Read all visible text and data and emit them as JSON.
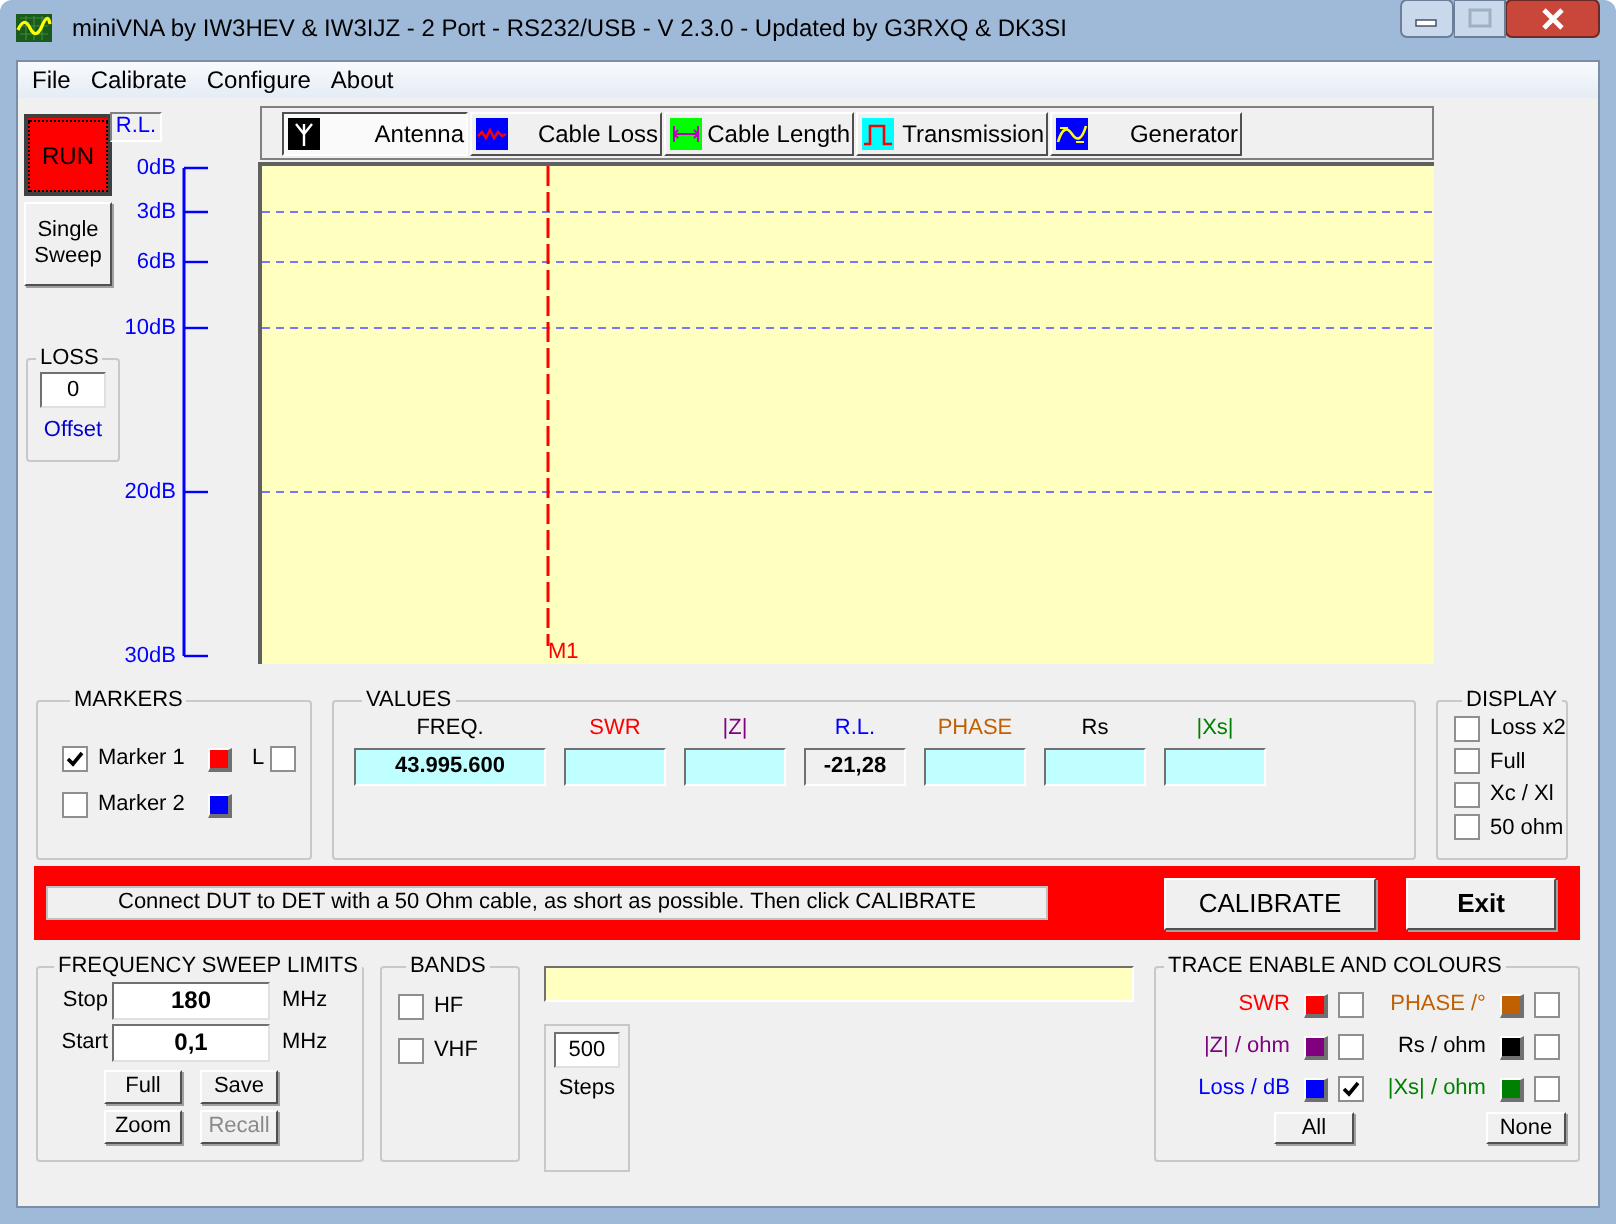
{
  "window": {
    "title": "miniVNA by IW3HEV & IW3IJZ - 2 Port - RS232/USB - V 2.3.0 - Updated by G3RXQ & DK3SI"
  },
  "menu": [
    "File",
    "Calibrate",
    "Configure",
    "About"
  ],
  "run_button": {
    "label": "RUN"
  },
  "single_sweep_button": {
    "label": "Single Sweep"
  },
  "loss": {
    "title": "LOSS",
    "value": "0",
    "label": "Offset"
  },
  "scale": {
    "title": "R.L.",
    "ticks": [
      "0dB",
      "3dB",
      "6dB",
      "10dB",
      "20dB",
      "30dB"
    ]
  },
  "tabs": [
    {
      "label": "Antenna",
      "selected": true
    },
    {
      "label": "Cable Loss",
      "selected": false
    },
    {
      "label": "Cable Length",
      "selected": false
    },
    {
      "label": "Transmission",
      "selected": false
    },
    {
      "label": "Generator",
      "selected": false
    }
  ],
  "marker_line": {
    "label": "M1"
  },
  "markers": {
    "title": "MARKERS",
    "items": [
      {
        "label": "Marker 1",
        "checked": true,
        "color": "#ff0000"
      },
      {
        "label": "Marker 2",
        "checked": false,
        "color": "#0000ff"
      }
    ],
    "l_label": "L",
    "l_checked": false
  },
  "values": {
    "title": "VALUES",
    "fields": [
      {
        "label": "FREQ.",
        "color": "#000000",
        "value": "43.995.600"
      },
      {
        "label": "SWR",
        "color": "#ff0000"
      },
      {
        "label": "|Z|",
        "color": "#800080"
      },
      {
        "label": "R.L.",
        "color": "#0000ff",
        "value": "-21,28"
      },
      {
        "label": "PHASE",
        "color": "#c06000"
      },
      {
        "label": "Rs",
        "color": "#000000"
      },
      {
        "label": "|Xs|",
        "color": "#008000"
      }
    ]
  },
  "display": {
    "title": "DISPLAY",
    "options": [
      {
        "label": "Loss x2",
        "checked": false
      },
      {
        "label": "Full",
        "checked": false
      },
      {
        "label": "Xc / Xl",
        "checked": false
      },
      {
        "label": "50 ohm",
        "checked": false
      }
    ]
  },
  "calibration": {
    "message": "Connect DUT to DET with a 50 Ohm cable, as short as possible. Then click CALIBRATE",
    "calibrate_button": "CALIBRATE",
    "exit_button": "Exit"
  },
  "sweep": {
    "title": "FREQUENCY SWEEP LIMITS",
    "stop": {
      "label": "Stop",
      "value": "180",
      "unit": "MHz"
    },
    "start": {
      "label": "Start",
      "value": "0,1",
      "unit": "MHz"
    },
    "buttons": [
      {
        "label": "Full",
        "disabled": false
      },
      {
        "label": "Save",
        "disabled": false
      },
      {
        "label": "Zoom",
        "disabled": false
      },
      {
        "label": "Recall",
        "disabled": true
      }
    ]
  },
  "bands": {
    "title": "BANDS",
    "options": [
      {
        "label": "HF",
        "checked": false
      },
      {
        "label": "VHF",
        "checked": false
      }
    ]
  },
  "steps": {
    "value": "500",
    "label": "Steps"
  },
  "traces": {
    "title": "TRACE ENABLE AND COLOURS",
    "items": [
      {
        "label": "SWR",
        "color": "#ff0000",
        "checked": false
      },
      {
        "label": "PHASE /°",
        "color": "#c06000",
        "checked": false
      },
      {
        "label": "|Z| / ohm",
        "color": "#800080",
        "checked": false
      },
      {
        "label": "Rs / ohm",
        "color": "#000000",
        "checked": false
      },
      {
        "label": "Loss / dB",
        "color": "#0000ff",
        "checked": true
      },
      {
        "label": "|Xs| / ohm",
        "color": "#008000",
        "checked": false
      }
    ],
    "buttons": [
      "All",
      "None"
    ]
  }
}
